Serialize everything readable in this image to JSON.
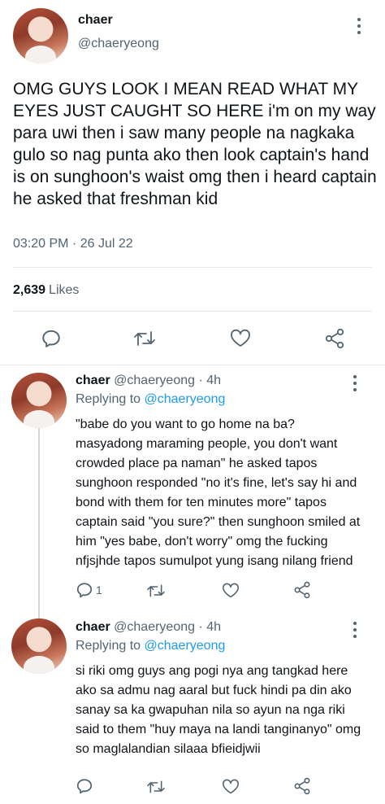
{
  "main_tweet": {
    "display_name": "chaer",
    "handle": "@chaeryeong",
    "text": "OMG GUYS LOOK I MEAN READ WHAT MY EYES JUST CAUGHT SO HERE i'm on my way para uwi then i saw many people na nagkaka gulo so nag punta ako then look captain's hand is on sunghoon's waist omg then i heard captain he asked that freshman kid",
    "timestamp": "03:20 PM · 26 Jul 22",
    "likes_count": "2,639",
    "likes_label": "Likes"
  },
  "replies": [
    {
      "display_name": "chaer",
      "handle_time": "@chaeryeong · 4h",
      "replying_prefix": "Replying to",
      "replying_to": "@chaeryeong",
      "text": "\"babe do you want to go home na ba? masyadong maraming people, you don't want crowded place pa naman\" he asked tapos sunghoon responded \"no it's fine, let's say hi and bond with them for ten minutes more\" tapos captain said \"you sure?\" then sunghoon smiled at him \"yes babe, don't worry\" omg the fucking nfjsjhde tapos sumulpot yung isang nilang friend",
      "reply_count": "1"
    },
    {
      "display_name": "chaer",
      "handle_time": "@chaeryeong · 4h",
      "replying_prefix": "Replying to",
      "replying_to": "@chaeryeong",
      "text": "si riki omg guys ang pogi nya ang tangkad here ako sa admu nag aaral but fuck hindi pa din ako sanay sa ka gwapuhan nila so ayun na nga riki said to them \"huy maya na landi tanginanyo\" omg so maglalandian silaaa bfieidjwii",
      "reply_count": ""
    }
  ],
  "icons": {
    "reply": "reply-bubble-icon",
    "retweet": "retweet-icon",
    "like": "heart-icon",
    "share": "share-icon",
    "more": "more-dots-icon"
  },
  "colors": {
    "text": "#0f1419",
    "secondary": "#536471",
    "mention": "#1d9bf0",
    "divider": "#e6e9ec"
  }
}
